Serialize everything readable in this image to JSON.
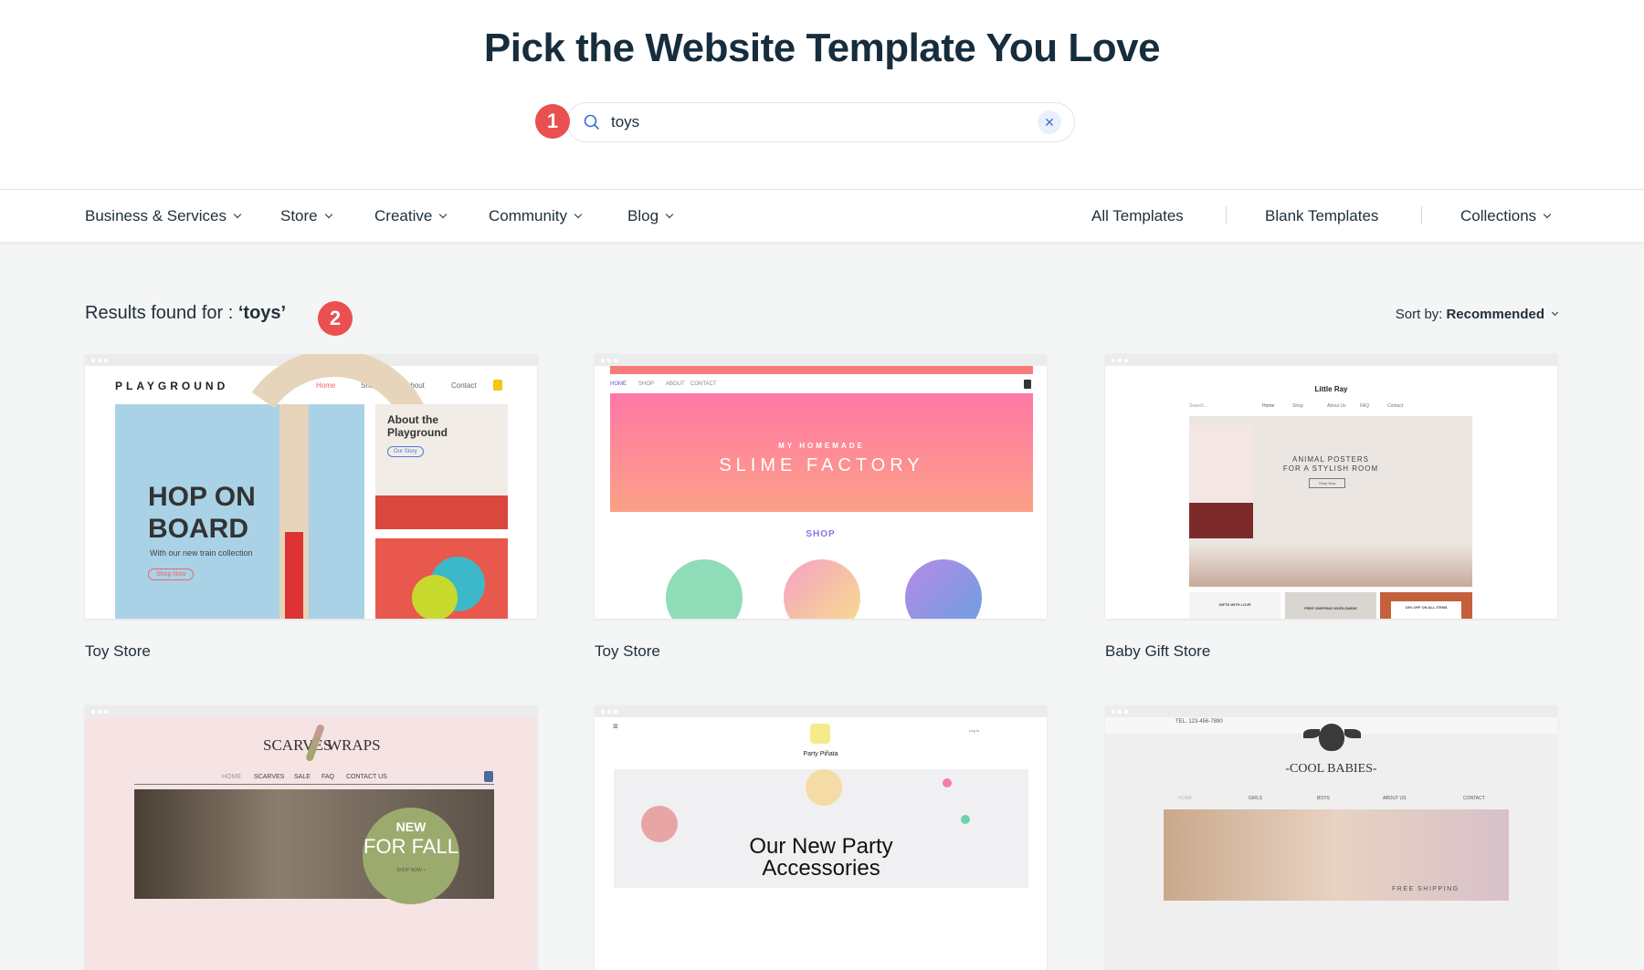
{
  "header": {
    "title": "Pick the Website Template You Love"
  },
  "search": {
    "value": "toys",
    "badge": "1",
    "clear_icon": "close-icon"
  },
  "nav": {
    "left": [
      {
        "label": "Business & Services"
      },
      {
        "label": "Store"
      },
      {
        "label": "Creative"
      },
      {
        "label": "Community"
      },
      {
        "label": "Blog"
      }
    ],
    "right": {
      "all": "All Templates",
      "blank": "Blank Templates",
      "collections": "Collections"
    }
  },
  "results": {
    "prefix": "Results found for : ",
    "query": "‘toys’",
    "badge": "2"
  },
  "sort": {
    "label": "Sort by:",
    "value": "Recommended"
  },
  "colors": {
    "accent_badge": "#e9504f",
    "search_icon": "#3b6fd6",
    "page_bg": "#f4f5f5"
  },
  "templates": [
    {
      "name": "Toy Store",
      "preview": {
        "logo": "PLAYGROUND",
        "nav": [
          "Home",
          "Shop",
          "About",
          "Contact"
        ],
        "headline1": "HOP ON",
        "headline2": "BOARD",
        "sub": "With our new train collection",
        "cta": "Shop Now",
        "side_title": "About the Playground",
        "side_cta": "Our Story"
      }
    },
    {
      "name": "Toy Store",
      "preview": {
        "nav": [
          "HOME",
          "SHOP",
          "ABOUT",
          "CONTACT"
        ],
        "kicker": "MY HOMEMADE",
        "headline": "SLIME FACTORY",
        "section": "SHOP"
      }
    },
    {
      "name": "Baby Gift Store",
      "preview": {
        "logo": "Little Ray",
        "search": "Search...",
        "nav": [
          "Home",
          "Shop",
          "About Us",
          "FAQ",
          "Contact"
        ],
        "headline1": "ANIMAL POSTERS",
        "headline2": "FOR A STYLISH ROOM",
        "cta": "Shop Now",
        "tiles": [
          "GIFTS WITH LOVE",
          "FREE SHIPPING WORLDWIDE",
          "15% OFF ON ALL ITEMS"
        ]
      }
    },
    {
      "preview": {
        "logo_left": "SCARVES",
        "logo_right": "WRAPS",
        "nav": [
          "HOME",
          "SCARVES",
          "SALE",
          "FAQ",
          "CONTACT US"
        ],
        "badge1": "NEW",
        "badge2": "FOR FALL",
        "cta": "SHOP NOW »"
      }
    },
    {
      "preview": {
        "logo": "Party Piñata",
        "login": "Log In",
        "headline1": "Our New Party",
        "headline2": "Accessories"
      }
    },
    {
      "preview": {
        "phone": "TEL. 123-456-7890",
        "logo": "-COOL BABIES-",
        "nav": [
          "HOME",
          "GIRLS",
          "BOYS",
          "ABOUT US",
          "CONTACT"
        ],
        "banner": "FREE SHIPPING"
      }
    }
  ]
}
